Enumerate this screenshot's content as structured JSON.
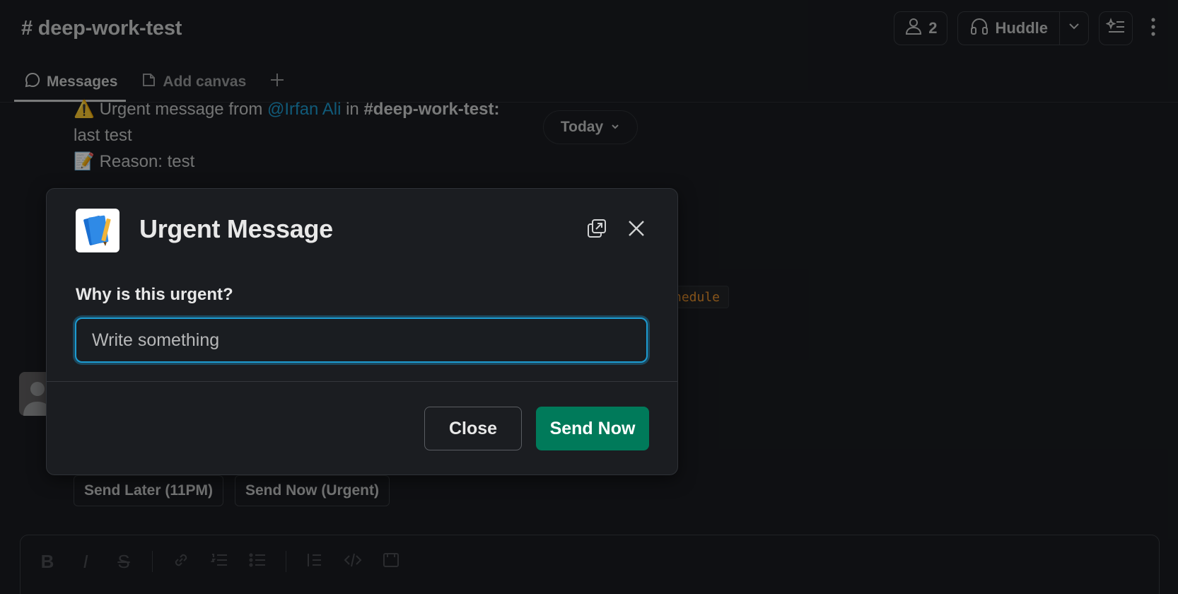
{
  "header": {
    "channel_title": "# deep-work-test",
    "member_count": "2",
    "huddle_label": "Huddle"
  },
  "tabs": [
    {
      "label": "Messages"
    },
    {
      "label": "Add canvas"
    }
  ],
  "background": {
    "alert_prefix": "Urgent message from",
    "mention": "@Irfan Ali",
    "in_word": "in",
    "channel_ref": "#deep-work-test:",
    "body_line": "last test",
    "reason_line": "Reason: test",
    "date_pill": "Today",
    "code_snippet": "hedule",
    "send_later_label": "Send Later (11PM)",
    "send_now_urgent_label": "Send Now (Urgent)"
  },
  "composer": {
    "format_buttons": [
      "B",
      "I",
      "S"
    ]
  },
  "modal": {
    "title": "Urgent Message",
    "field_label": "Why is this urgent?",
    "field_placeholder": "Write something",
    "field_value": "",
    "close_label": "Close",
    "send_label": "Send Now"
  },
  "colors": {
    "accent_link": "#1d9bd1",
    "primary_button": "#007a5a",
    "background": "#1a1d21"
  },
  "icons": {
    "members": "person-icon",
    "huddle": "headphones-icon",
    "canvas": "canvas-icon",
    "modal_popout": "popout-icon",
    "modal_close": "close-icon"
  }
}
